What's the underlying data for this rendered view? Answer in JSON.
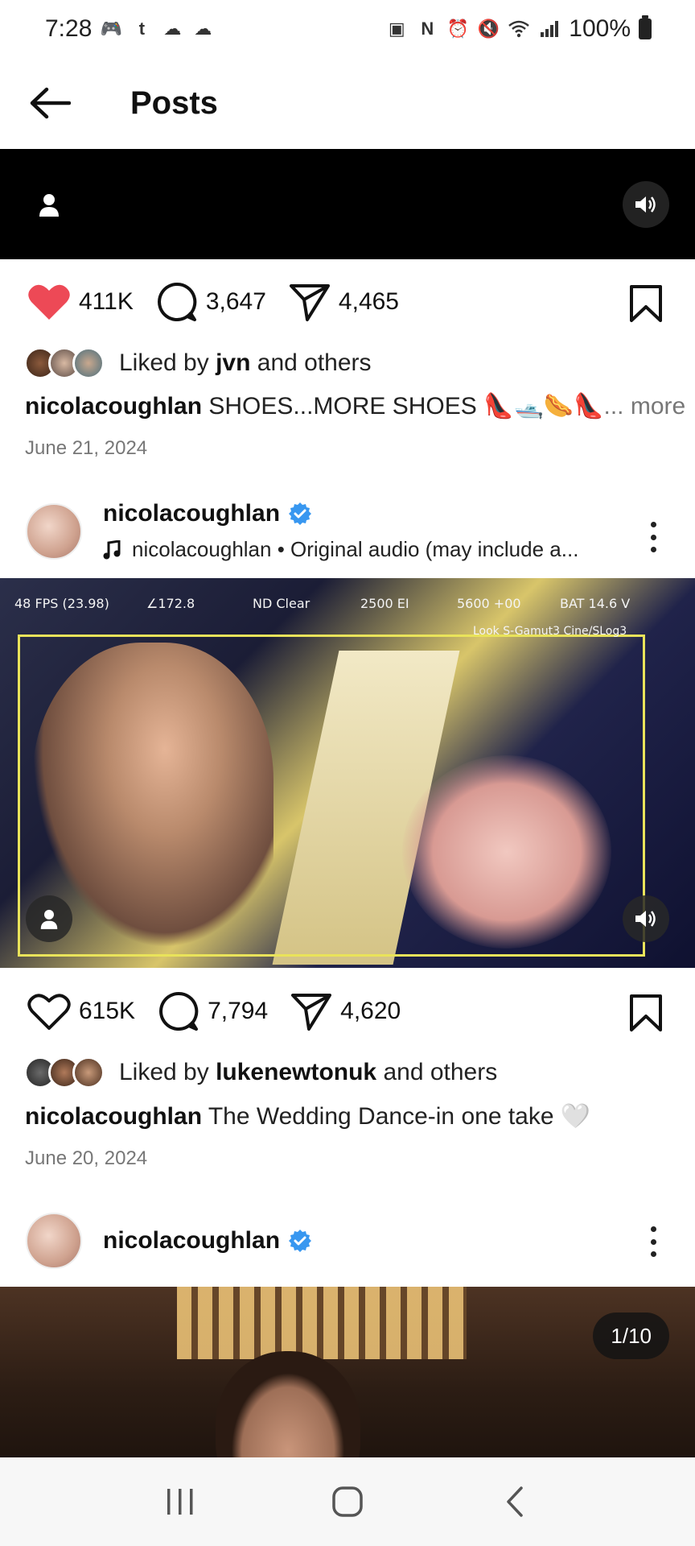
{
  "status_bar": {
    "time": "7:28",
    "battery_text": "100%",
    "left_icons": [
      "discord-icon",
      "tumblr-icon",
      "cloud-icon",
      "soundcloud-icon"
    ],
    "right_icons": [
      "battery-saver-icon",
      "nfc-icon",
      "alarm-icon",
      "mute-icon",
      "wifi-icon",
      "signal-icon"
    ]
  },
  "header": {
    "title": "Posts"
  },
  "posts": [
    {
      "likes": "411K",
      "comments": "3,647",
      "shares": "4,465",
      "liked": true,
      "liked_by_prefix": "Liked by ",
      "liked_by_user": "jvn",
      "liked_by_suffix": " and others",
      "caption_user": "nicolacoughlan",
      "caption_text": " SHOES...MORE SHOES 👠🛥️🌭👠",
      "caption_more": "... more",
      "date": "June 21, 2024"
    },
    {
      "username": "nicolacoughlan",
      "audio": "nicolacoughlan • Original audio (may include a...",
      "video_overlay": {
        "fps": "48 FPS (23.98)",
        "shutter": "∠172.8",
        "nd": "ND Clear",
        "ei": "2500 EI",
        "wb": "5600 +00",
        "bat": "BAT 14.6 V",
        "look": "Look S-Gamut3 Cine/SLog3"
      },
      "likes": "615K",
      "comments": "7,794",
      "shares": "4,620",
      "liked": false,
      "liked_by_prefix": "Liked by ",
      "liked_by_user": "lukenewtonuk",
      "liked_by_suffix": " and others",
      "caption_user": "nicolacoughlan",
      "caption_text": " The Wedding Dance-in one take 🤍",
      "date": "June 20, 2024"
    },
    {
      "username": "nicolacoughlan",
      "carousel_counter": "1/10"
    }
  ],
  "colors": {
    "like_red": "#ed4956",
    "verified_blue": "#3897f0",
    "text_primary": "#111111",
    "text_secondary": "#777777"
  }
}
